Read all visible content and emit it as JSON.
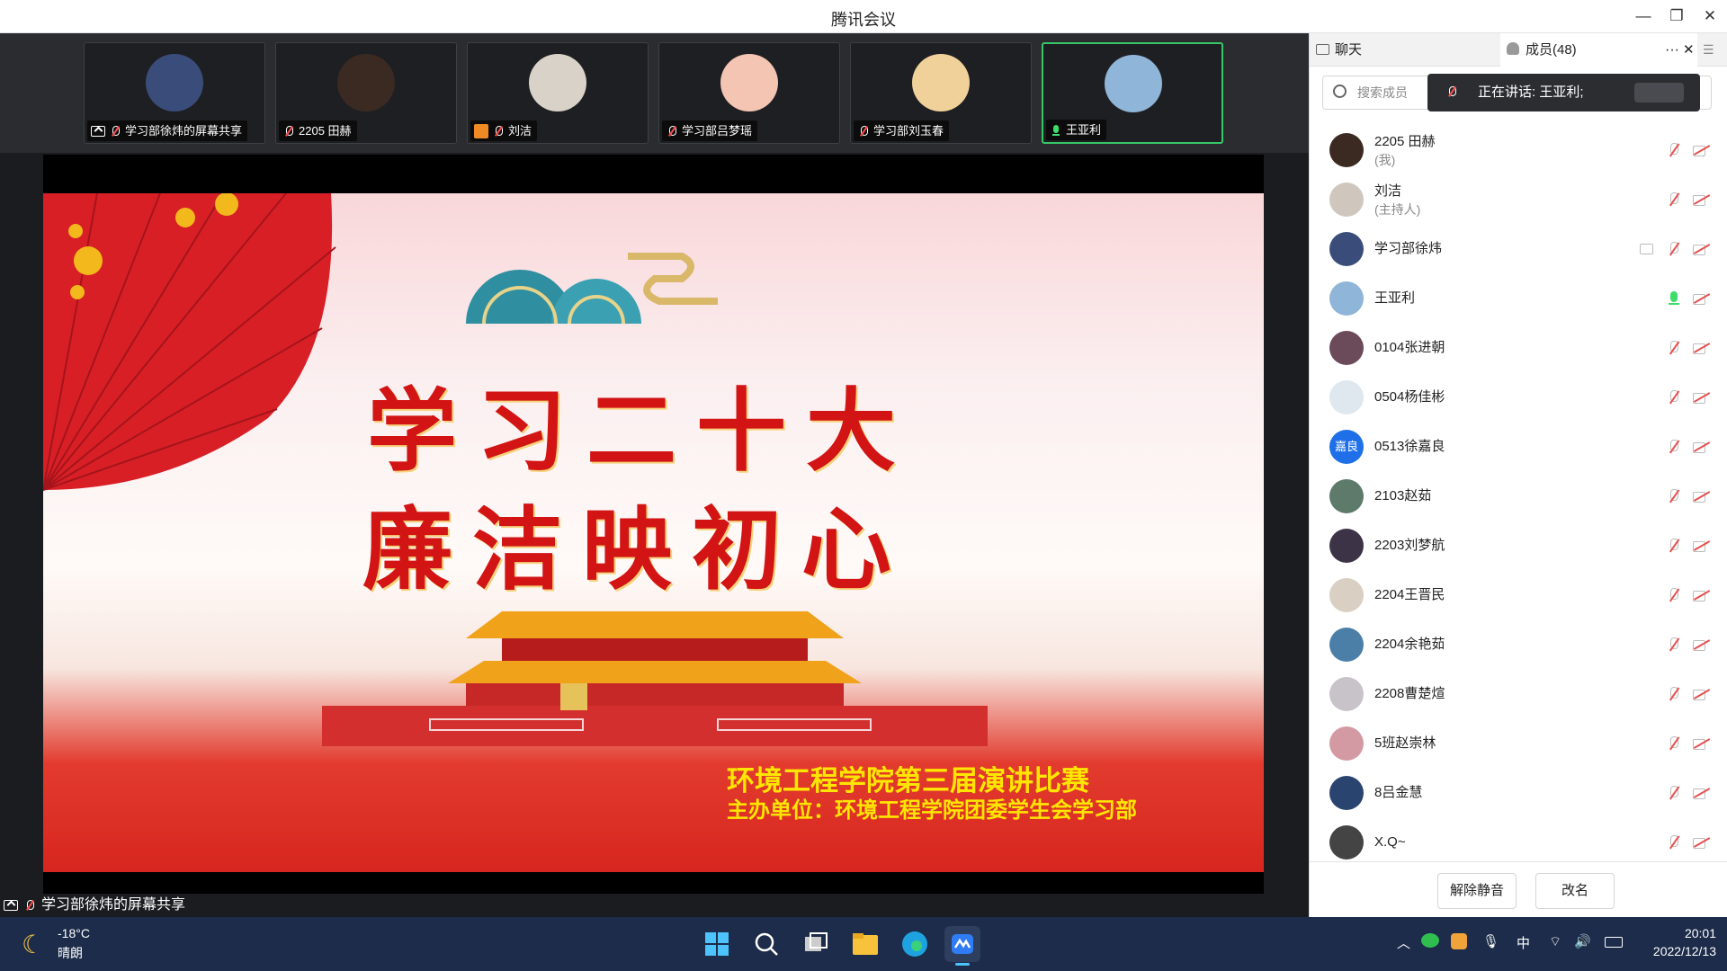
{
  "window": {
    "title": "腾讯会议"
  },
  "thumbnails": [
    {
      "name": "学习部徐炜的屏幕共享",
      "sharing": true,
      "mic": "off",
      "color": "#3a4d7a"
    },
    {
      "name": "2205 田赫",
      "sharing": false,
      "mic": "off",
      "color": "#3b2a22"
    },
    {
      "name": "刘洁",
      "sharing": false,
      "mic": "off",
      "host": true,
      "color": "#d9d2c8"
    },
    {
      "name": "学习部吕梦瑶",
      "sharing": false,
      "mic": "off",
      "color": "#f3c5b2"
    },
    {
      "name": "学习部刘玉春",
      "sharing": false,
      "mic": "off",
      "color": "#f1d19a"
    },
    {
      "name": "王亚利",
      "sharing": false,
      "mic": "on",
      "active": true,
      "color": "#8fb5d8"
    }
  ],
  "slide": {
    "title_line1": "学习二十大",
    "title_line2": "廉洁映初心",
    "subtitle1": "环境工程学院第三届演讲比赛",
    "subtitle2": "主办单位：环境工程学院团委学生会学习部"
  },
  "share_caption": "学习部徐炜的屏幕共享",
  "sidebar": {
    "tab_chat": "聊天",
    "tab_members": "成员(48)",
    "more": "···",
    "close": "✕",
    "search_placeholder": "搜索成员",
    "speaking": "正在讲话: 王亚利;",
    "members": [
      {
        "name": "2205 田赫",
        "role": "(我)",
        "mic": "off",
        "color": "#3b2a22"
      },
      {
        "name": "刘洁",
        "role": "(主持人)",
        "mic": "off",
        "color": "#cfc7bd"
      },
      {
        "name": "学习部徐炜",
        "role": "",
        "mic": "off",
        "share": true,
        "color": "#3a4d7a"
      },
      {
        "name": "王亚利",
        "role": "",
        "mic": "on",
        "color": "#8fb5d8"
      },
      {
        "name": "0104张进朝",
        "role": "",
        "mic": "off",
        "color": "#6b4a5a"
      },
      {
        "name": "0504杨佳彬",
        "role": "",
        "mic": "off",
        "color": "#dfe8ef"
      },
      {
        "name": "0513徐嘉良",
        "role": "",
        "mic": "off",
        "color": "#1e6fe8",
        "initials": "嘉良"
      },
      {
        "name": "2103赵茹",
        "role": "",
        "mic": "off",
        "color": "#5d7a6a"
      },
      {
        "name": "2203刘梦航",
        "role": "",
        "mic": "off",
        "color": "#3d3346"
      },
      {
        "name": "2204王晋民",
        "role": "",
        "mic": "off",
        "color": "#d9cfc2"
      },
      {
        "name": "2204余艳茹",
        "role": "",
        "mic": "off",
        "color": "#4b7fa8"
      },
      {
        "name": "2208曹楚煊",
        "role": "",
        "mic": "off",
        "color": "#c8c3c9"
      },
      {
        "name": "5班赵崇林",
        "role": "",
        "mic": "off",
        "color": "#d49aa3"
      },
      {
        "name": "8吕金慧",
        "role": "",
        "mic": "off",
        "color": "#2a4470"
      },
      {
        "name": "X.Q~",
        "role": "",
        "mic": "off",
        "color": "#444"
      }
    ],
    "btn_unmute": "解除静音",
    "btn_rename": "改名"
  },
  "taskbar": {
    "weather_temp": "-18°C",
    "weather_desc": "晴朗",
    "ime": "中",
    "time": "20:01",
    "date": "2022/12/13"
  }
}
